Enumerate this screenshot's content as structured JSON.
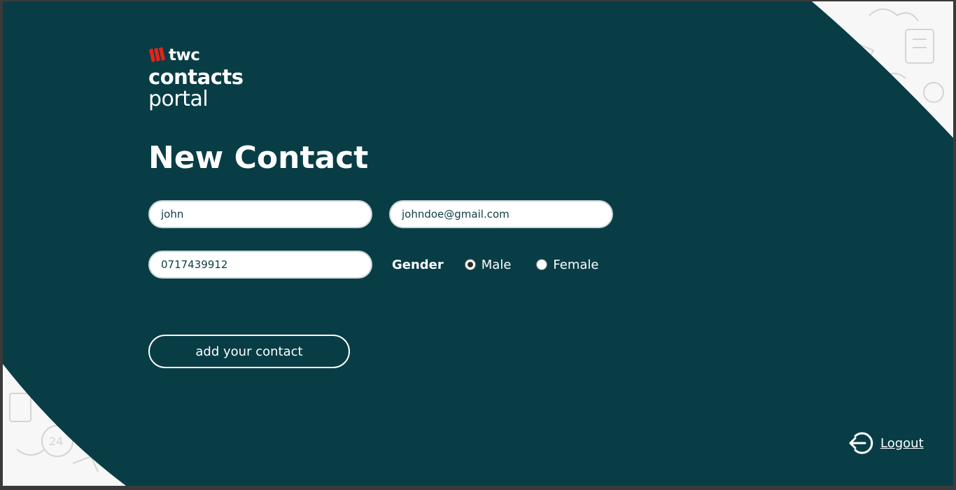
{
  "brand": {
    "twc": "twc",
    "contacts": "contacts",
    "portal": "portal"
  },
  "page": {
    "title": "New Contact"
  },
  "form": {
    "name_value": "john",
    "email_value": "johndoe@gmail.com",
    "phone_value": "0717439912",
    "gender_label": "Gender",
    "gender_options": [
      "Male",
      "Female"
    ],
    "gender_selected": "Male",
    "submit_label": "add your contact"
  },
  "nav": {
    "logout_label": "Logout"
  },
  "icons": {
    "brand": "twc-logo-mark",
    "logout": "logout-icon"
  },
  "colors": {
    "panel": "#083d46",
    "accent": "#e3241b",
    "background": "#f7f7f7",
    "text": "#ffffff"
  }
}
